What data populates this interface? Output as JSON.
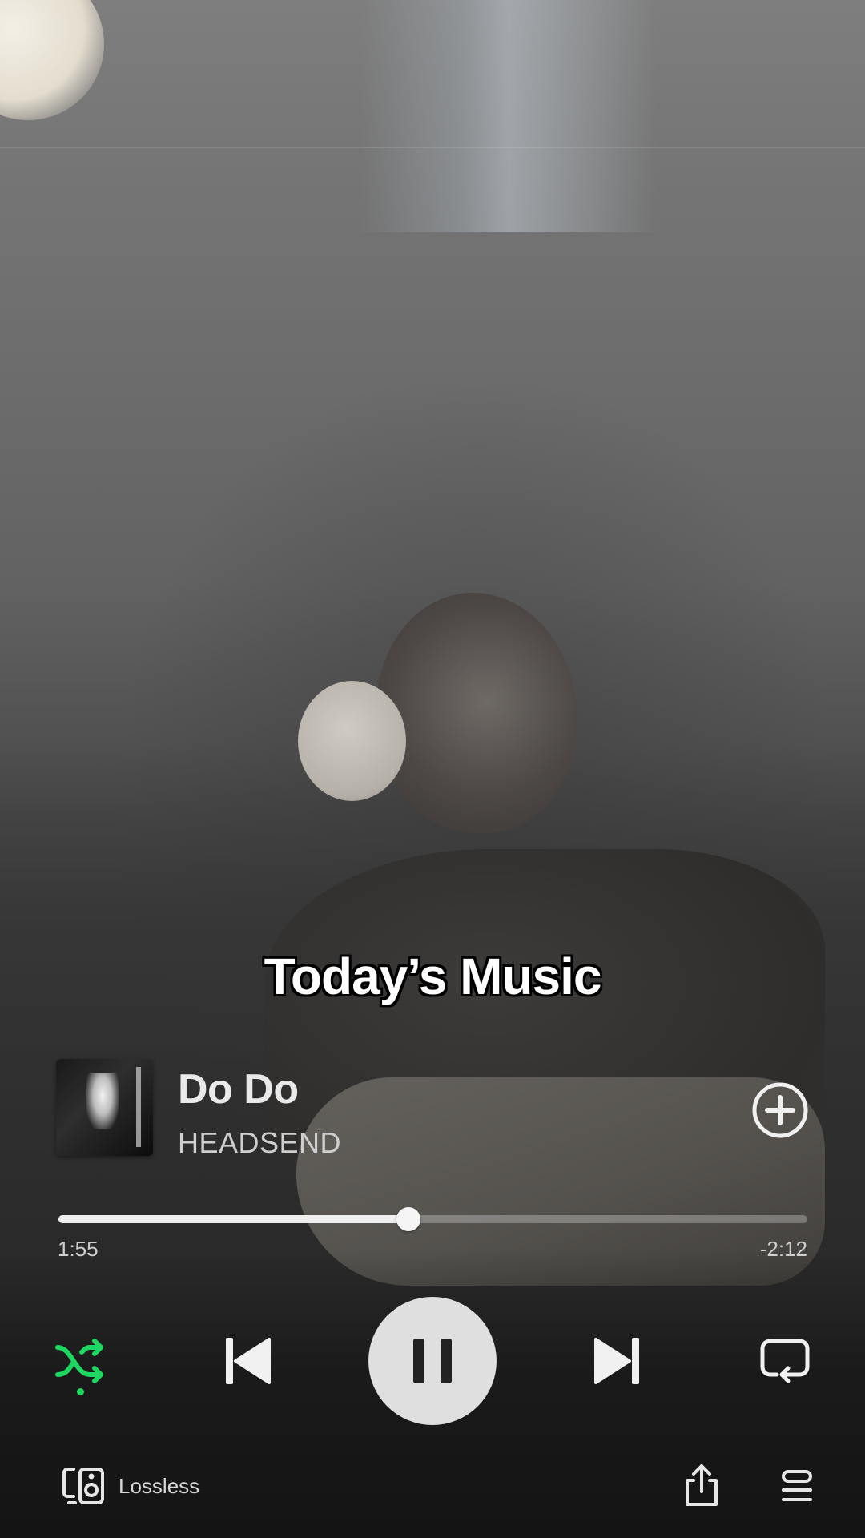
{
  "caption": "Today’s Music",
  "track": {
    "title": "Do Do",
    "artist": "HEADSEND",
    "album_art_icon": "album-cover"
  },
  "progress": {
    "elapsed": "1:55",
    "remaining": "-2:12",
    "fraction": 0.467
  },
  "controls": {
    "shuffle_icon": "shuffle-icon",
    "shuffle_active": true,
    "previous_icon": "skip-previous-icon",
    "play_pause_icon": "pause-icon",
    "next_icon": "skip-next-icon",
    "repeat_icon": "repeat-icon",
    "add_icon": "plus-circle-icon"
  },
  "bottom_bar": {
    "device_icon": "connect-device-icon",
    "quality_label": "Lossless",
    "share_icon": "share-icon",
    "queue_icon": "queue-icon"
  },
  "colors": {
    "accent": "#1ed760",
    "foreground": "#f0f0f0"
  }
}
